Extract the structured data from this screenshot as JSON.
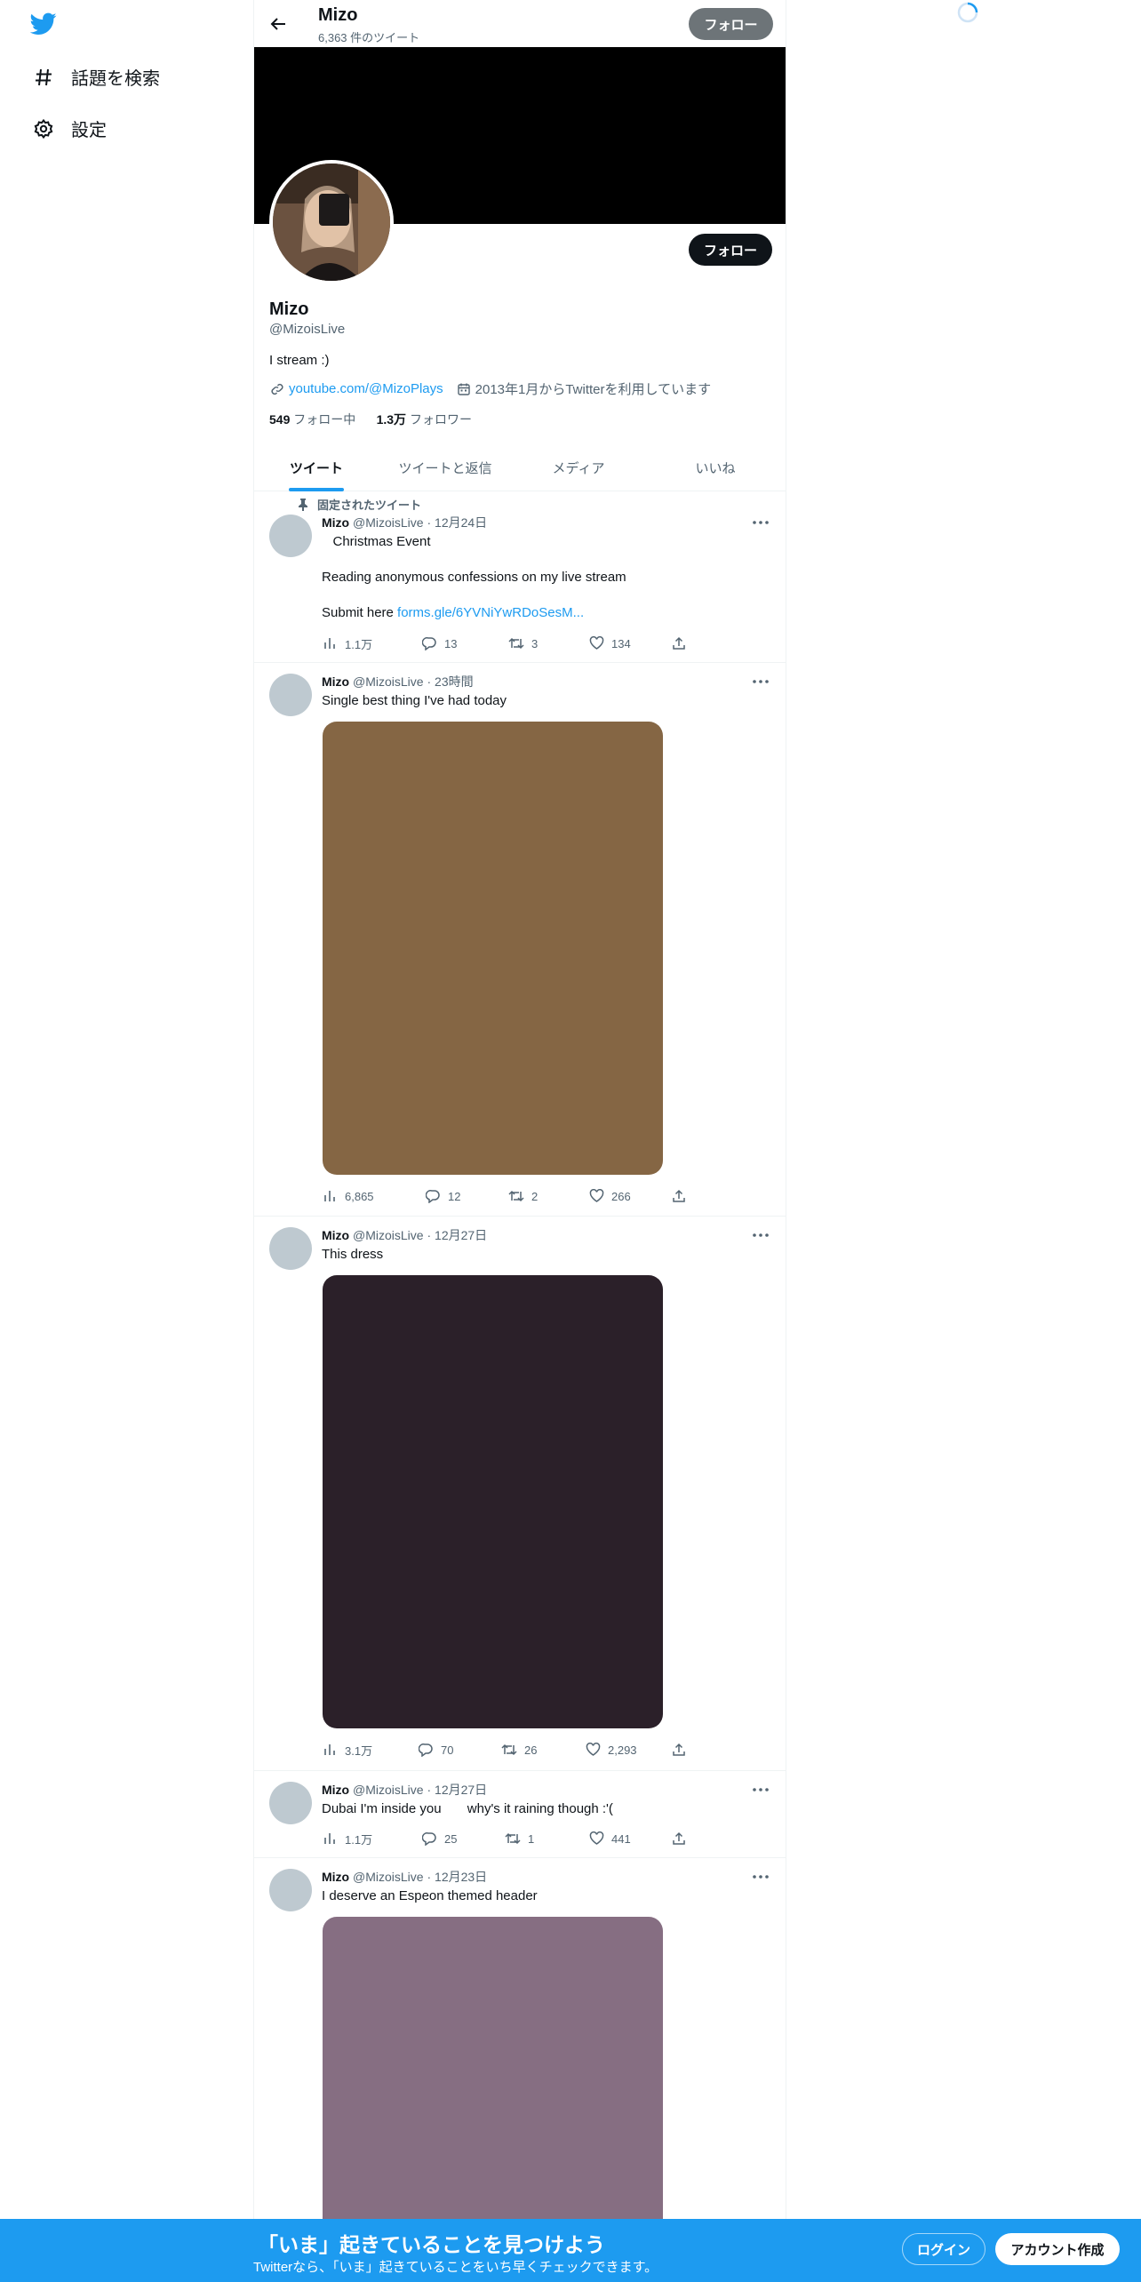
{
  "nav": {
    "items": [
      {
        "label": "話題を検索",
        "icon": "hashtag-icon"
      },
      {
        "label": "設定",
        "icon": "gear-icon"
      }
    ]
  },
  "header": {
    "name": "Mizo",
    "tweet_count": "6,363 件のツイート",
    "follow_label": "フォロー"
  },
  "profile": {
    "name": "Mizo",
    "handle": "@MizoisLive",
    "bio": "I stream :)",
    "link": "youtube.com/@MizoPlays",
    "joined": "2013年1月からTwitterを利用しています",
    "following_count": "549",
    "following_label": "フォロー中",
    "followers_count": "1.3万",
    "followers_label": "フォロワー",
    "follow_label": "フォロー"
  },
  "tabs": [
    "ツイート",
    "ツイートと返信",
    "メディア",
    "いいね"
  ],
  "tweets": [
    {
      "pinned_label": "固定されたツイート",
      "name": "Mizo",
      "handle": "@MizoisLive",
      "sep": "·",
      "time": "12月24日",
      "line1": "   Christmas Event",
      "line2": "Reading anonymous confessions on my live stream",
      "line3": "Submit here ",
      "link": "forms.gle/6YVNiYwRDoSesM...",
      "views": "1.1万",
      "replies": "13",
      "retweets": "3",
      "likes": "134"
    },
    {
      "name": "Mizo",
      "handle": "@MizoisLive",
      "sep": "·",
      "time": "23時間",
      "text": "Single best thing I've had today",
      "media_color": "#856644",
      "views": "6,865",
      "replies": "12",
      "retweets": "2",
      "likes": "266"
    },
    {
      "name": "Mizo",
      "handle": "@MizoisLive",
      "sep": "·",
      "time": "12月27日",
      "text": "This dress",
      "media_color": "#2b2029",
      "views": "3.1万",
      "replies": "70",
      "retweets": "26",
      "likes": "2,293"
    },
    {
      "name": "Mizo",
      "handle": "@MizoisLive",
      "sep": "·",
      "time": "12月27日",
      "text": "Dubai I'm inside you       why's it raining though :'(",
      "views": "1.1万",
      "replies": "25",
      "retweets": "1",
      "likes": "441"
    },
    {
      "name": "Mizo",
      "handle": "@MizoisLive",
      "sep": "·",
      "time": "12月23日",
      "text": "I deserve an Espeon themed header",
      "media_color": "#866e82"
    }
  ],
  "bottom_bar": {
    "title": "「いま」起きていることを見つけよう",
    "subtitle": "Twitterなら、「いま」起きていることをいち早くチェックできます。",
    "login_label": "ログイン",
    "signup_label": "アカウント作成"
  },
  "colors": {
    "accent": "#1d9bf0",
    "banner": "#000000",
    "avatar_placeholder": "#bec9d0"
  }
}
